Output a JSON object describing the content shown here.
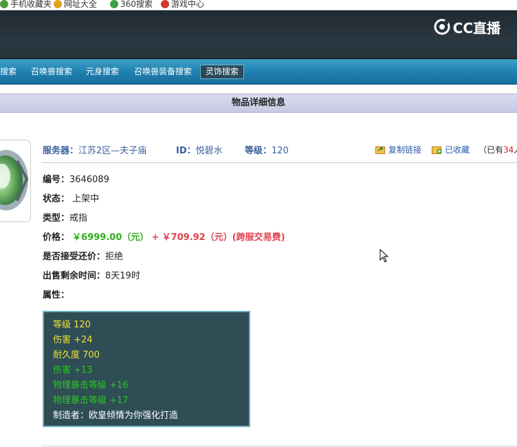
{
  "bookmarks": [
    {
      "label": "手机收藏夹",
      "color": "#4a9a3a"
    },
    {
      "label": "网址大全",
      "color": "#e1a21e"
    },
    {
      "label": "360搜索",
      "color": "#3aa04a"
    },
    {
      "label": "游戏中心",
      "color": "#d23a2a"
    }
  ],
  "logo": {
    "text": "CC直播"
  },
  "nav": {
    "items": [
      "搜索",
      "召唤兽搜索",
      "元身搜索",
      "召唤兽装备搜索",
      "灵饰搜索"
    ],
    "active_index": 4
  },
  "section": {
    "title": "物品详细信息"
  },
  "info": {
    "server_label": "服务器：",
    "server_value": "江苏2区—夫子庙",
    "id_label": "ID：",
    "id_value": "悦碧水",
    "level_label": "等级：",
    "level_value": "120"
  },
  "actions": {
    "copy_link": "复制链接",
    "favorited": "已收藏",
    "fav_prefix": "（已有",
    "fav_count": "34",
    "fav_suffix": "人收"
  },
  "details": {
    "serial_label": "编号：",
    "serial_value": "3646089",
    "status_label": "状态：",
    "status_value": "上架中",
    "type_label": "类型：",
    "type_value": "戒指",
    "price_label": "价格：",
    "price_value": "￥6999.00（元）",
    "price_plus": "+",
    "fee_value": "￥709.92（元）(跨服交易费)",
    "counter_label": "是否接受还价：",
    "counter_value": "拒绝",
    "remaining_label": "出售剩余时间：",
    "remaining_value": "8天19时",
    "attr_label": "属性："
  },
  "attributes": [
    {
      "text": "等级 120",
      "color": "#f0e23c"
    },
    {
      "text": "伤害 +24",
      "color": "#f0e23c"
    },
    {
      "text": "耐久度 700",
      "color": "#f0e23c"
    },
    {
      "text": "伤害 +13",
      "color": "#27c81e"
    },
    {
      "text": "物理暴击等级 +16",
      "color": "#27c81e"
    },
    {
      "text": "物理暴击等级 +17",
      "color": "#27c81e"
    },
    {
      "text": "制造者：欧皇倾情为你强化打造",
      "color": "#ffffff"
    }
  ],
  "icons": {
    "copy": "copy-link-icon",
    "favorite": "favorite-folder-icon",
    "cursor": "mouse-cursor-icon"
  }
}
